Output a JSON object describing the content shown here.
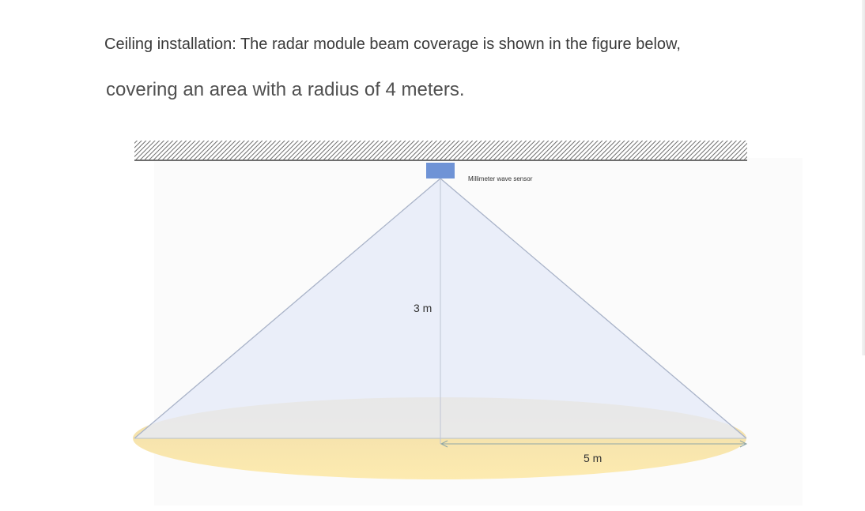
{
  "text": {
    "line1": "Ceiling installation: The radar module beam coverage is shown in the figure below,",
    "line2": "covering an area with a radius of 4 meters."
  },
  "diagram": {
    "sensor_label": "Millimeter wave sensor",
    "height_label": "3 m",
    "radius_label": "5 m",
    "colors": {
      "ceiling_hatch": "#6e6e6e",
      "sensor": "#6f93d6",
      "beam_fill": "#e6eaf8",
      "beam_edge": "#a9b3c8",
      "floor_fill": "#fbe7ac",
      "dimension_line": "#8fa6a6"
    }
  }
}
